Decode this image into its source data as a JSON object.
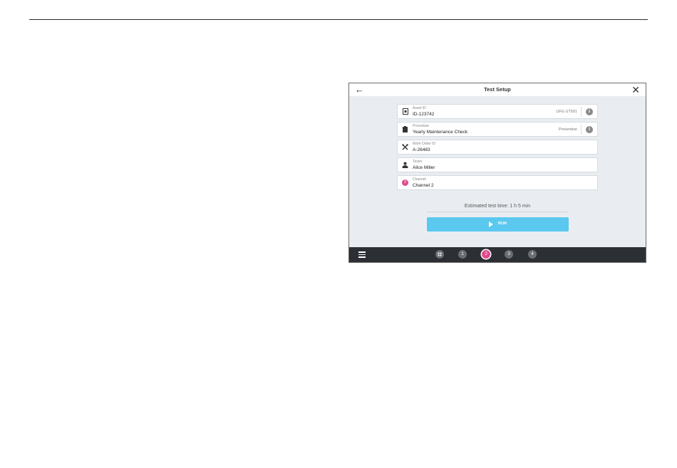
{
  "header": {
    "title": "Test Setup",
    "back_icon": "arrow-left-icon",
    "close_icon": "close-icon"
  },
  "fields": [
    {
      "icon": "asset-tag-icon",
      "label": "Asset ID",
      "value": "ID-123742",
      "tag": "UFG UT501",
      "info": "i"
    },
    {
      "icon": "clipboard-icon",
      "label": "Procedure",
      "value": "Yearly Maintenance Check",
      "tag": "Preventive",
      "info": "i"
    },
    {
      "icon": "wrench-icon",
      "label": "Work Order ID",
      "value": "A-26483"
    },
    {
      "icon": "user-icon",
      "label": "Tester",
      "value": "Alice Miller"
    },
    {
      "icon": "channel-icon",
      "label": "Channel",
      "value": "Channel 2",
      "badge": "2"
    }
  ],
  "estimate": "Estimated test time: 1 h 5 min",
  "run_label": "RUN",
  "steps": [
    "1",
    "2",
    "3",
    "4"
  ],
  "active_step": "2",
  "colors": {
    "accent": "#5bc8ef",
    "active_step": "#e2488c",
    "bottom_bar": "#2c2f33"
  }
}
